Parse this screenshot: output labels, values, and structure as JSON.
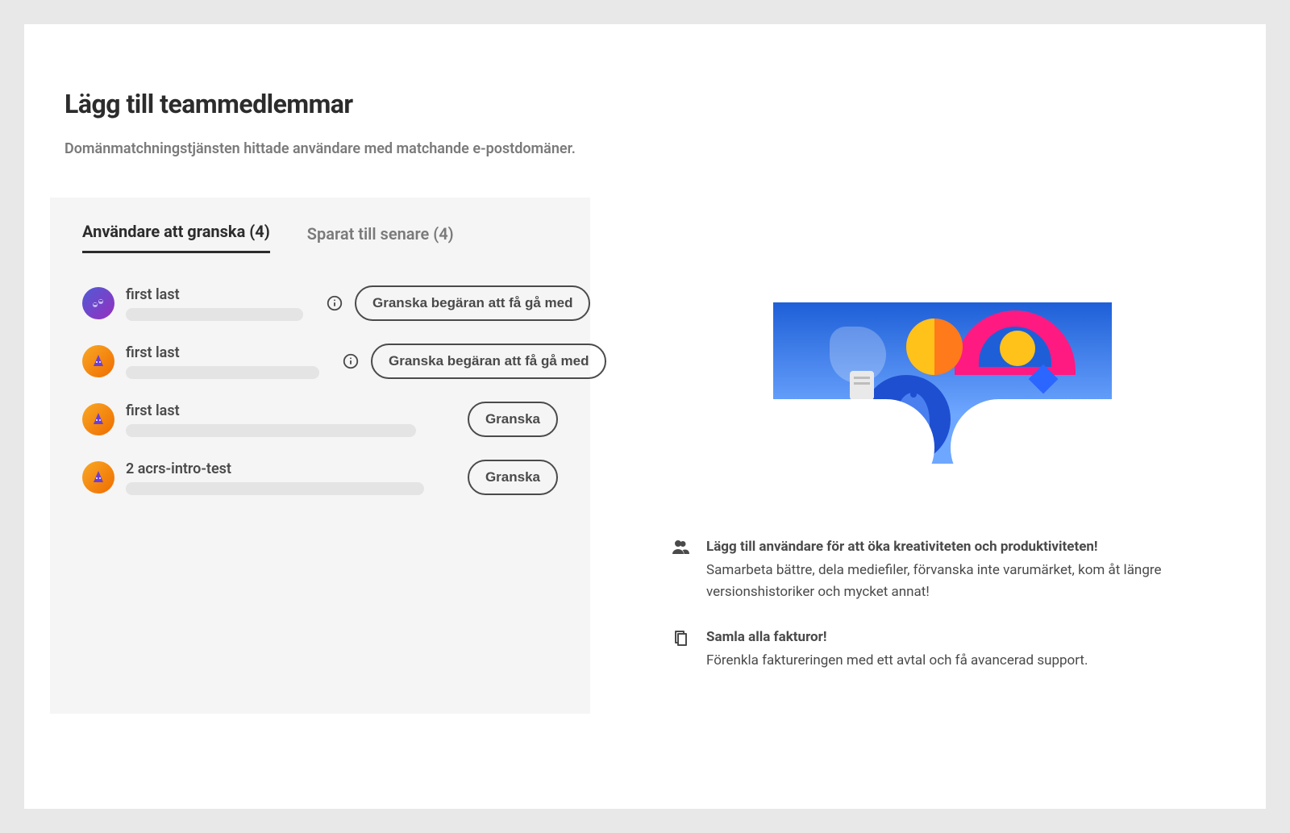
{
  "header": {
    "title": "Lägg till teammedlemmar",
    "subtitle": "Domänmatchningstjänsten hittade användare med matchande e-postdomäner."
  },
  "tabs": {
    "review": {
      "label": "Användare att granska (4)"
    },
    "saved": {
      "label": "Sparat till senare (4)"
    }
  },
  "users": [
    {
      "name": "first last",
      "action": "Granska begäran att få gå med",
      "info": true
    },
    {
      "name": "first last",
      "action": "Granska begäran att få gå med",
      "info": true
    },
    {
      "name": "first last",
      "action": "Granska",
      "info": false
    },
    {
      "name": "2 acrs-intro-test",
      "action": "Granska",
      "info": false
    }
  ],
  "benefits": {
    "users": {
      "heading": "Lägg till användare för att öka kreativiteten och produktiviteten!",
      "body": "Samarbeta bättre, dela mediefiler, förvanska inte varumärket, kom åt längre versionshistoriker och mycket annat!"
    },
    "billing": {
      "heading": "Samla alla fakturor!",
      "body": "Förenkla faktureringen med ett avtal och få avancerad support."
    }
  }
}
